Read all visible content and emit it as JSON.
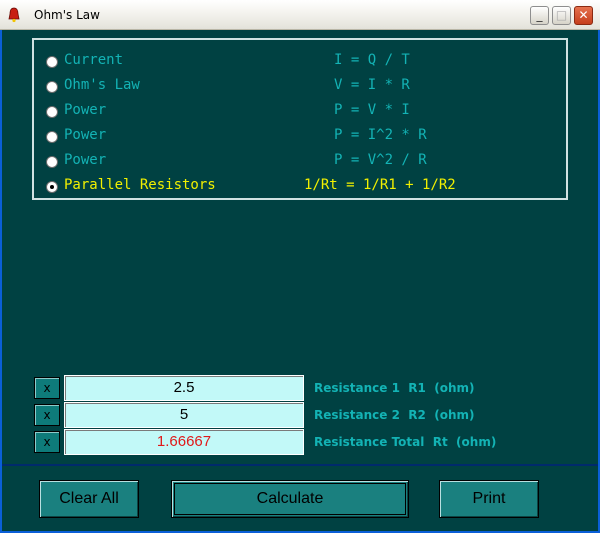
{
  "window": {
    "title": "Ohm's Law"
  },
  "formulas": [
    {
      "label": "Current",
      "equation": "I = Q / T",
      "selected": false
    },
    {
      "label": "Ohm's Law",
      "equation": "V = I * R",
      "selected": false
    },
    {
      "label": "Power",
      "equation": "P = V * I",
      "selected": false
    },
    {
      "label": "Power",
      "equation": "P = I^2 * R",
      "selected": false
    },
    {
      "label": "Power",
      "equation": "P = V^2 / R",
      "selected": false
    },
    {
      "label": "Parallel Resistors",
      "equation": "1/Rt = 1/R1 + 1/R2",
      "selected": true
    }
  ],
  "inputs": [
    {
      "clear_label": "x",
      "value": "2.5",
      "unit": "Resistance 1  R1  (ohm)"
    },
    {
      "clear_label": "x",
      "value": "5",
      "unit": "Resistance 2  R2  (ohm)"
    },
    {
      "clear_label": "x",
      "value": "1.66667",
      "unit": "Resistance Total  Rt  (ohm)"
    }
  ],
  "buttons": {
    "clear_all": "Clear All",
    "calculate": "Calculate",
    "print": "Print"
  },
  "colors": {
    "background": "#004142",
    "text": "#13b3b5",
    "selected_text": "#f1f000",
    "result": "#e0191a",
    "input_bg": "#c2f9f8"
  },
  "icons": {
    "app": "red-bell-icon",
    "minimize": "minimize-icon",
    "maximize": "maximize-icon",
    "close": "close-icon"
  }
}
